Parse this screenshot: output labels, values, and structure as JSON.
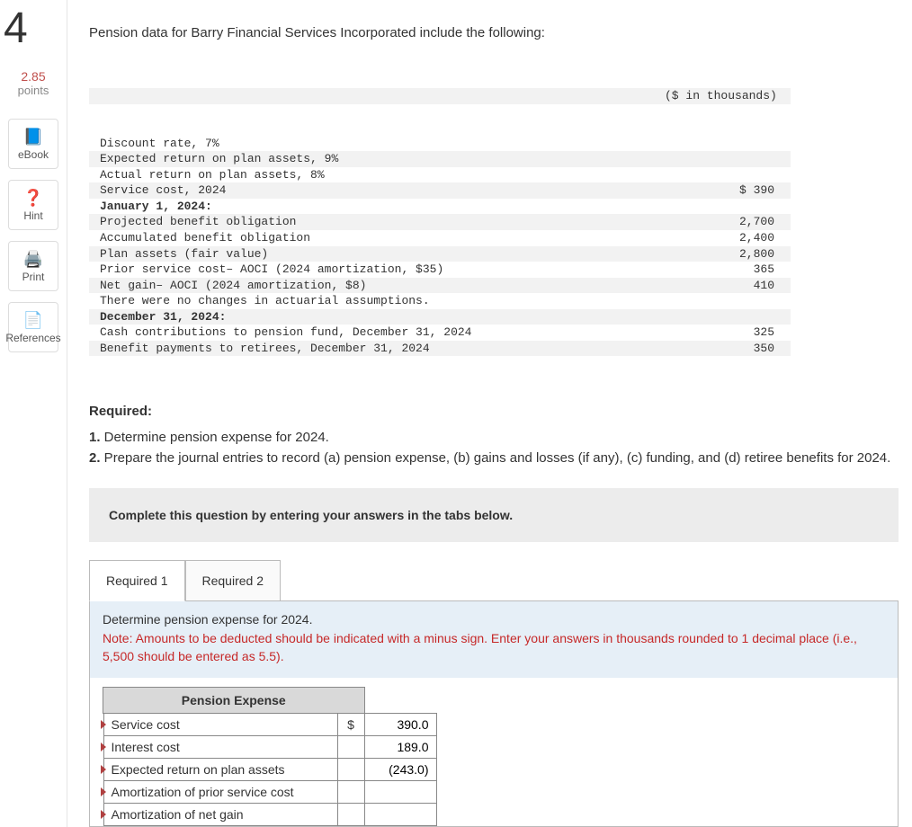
{
  "question_number": "4",
  "points": {
    "value": "2.85",
    "label": "points"
  },
  "side_buttons": [
    {
      "name": "ebook",
      "icon": "📘",
      "label": "eBook"
    },
    {
      "name": "hint",
      "icon": "❓",
      "label": "Hint"
    },
    {
      "name": "print",
      "icon": "🖨️",
      "label": "Print"
    },
    {
      "name": "references",
      "icon": "📄",
      "label": "References"
    }
  ],
  "intro": "Pension data for Barry Financial Services Incorporated include the following:",
  "data_header": "($ in thousands)",
  "data_rows": [
    {
      "label": "Discount rate, 7%",
      "value": "",
      "bold": false
    },
    {
      "label": "Expected return on plan assets, 9%",
      "value": "",
      "bold": false
    },
    {
      "label": "Actual return on plan assets, 8%",
      "value": "",
      "bold": false
    },
    {
      "label": "Service cost, 2024",
      "value": "$ 390",
      "bold": false
    },
    {
      "label": "January 1, 2024:",
      "value": "",
      "bold": true
    },
    {
      "label": "Projected benefit obligation",
      "value": "2,700",
      "bold": false
    },
    {
      "label": "Accumulated benefit obligation",
      "value": "2,400",
      "bold": false
    },
    {
      "label": "Plan assets (fair value)",
      "value": "2,800",
      "bold": false
    },
    {
      "label": "Prior service cost– AOCI (2024 amortization, $35)",
      "value": "365",
      "bold": false
    },
    {
      "label": "Net gain– AOCI (2024 amortization, $8)",
      "value": "410",
      "bold": false
    },
    {
      "label": "There were no changes in actuarial assumptions.",
      "value": "",
      "bold": false
    },
    {
      "label": "December 31, 2024:",
      "value": "",
      "bold": true
    },
    {
      "label": "Cash contributions to pension fund, December 31, 2024",
      "value": "325",
      "bold": false
    },
    {
      "label": "Benefit payments to retirees, December 31, 2024",
      "value": "350",
      "bold": false
    }
  ],
  "required_heading": "Required:",
  "requirements": [
    {
      "num": "1.",
      "text": "Determine pension expense for 2024."
    },
    {
      "num": "2.",
      "text": "Prepare the journal entries to record (a) pension expense, (b) gains and losses (if any), (c) funding, and (d) retiree benefits for 2024."
    }
  ],
  "instruction_box": "Complete this question by entering your answers in the tabs below.",
  "tabs": [
    {
      "label": "Required 1",
      "active": true
    },
    {
      "label": "Required 2",
      "active": false
    }
  ],
  "panel": {
    "prompt": "Determine pension expense for 2024.",
    "note": "Note: Amounts to be deducted should be indicated with a minus sign. Enter your answers in thousands rounded to 1 decimal place (i.e., 5,500 should be entered as 5.5).",
    "table_header": "Pension Expense",
    "rows": [
      {
        "label": "Service cost",
        "symbol": "$",
        "value": "390.0"
      },
      {
        "label": "Interest cost",
        "symbol": "",
        "value": "189.0"
      },
      {
        "label": "Expected return on plan assets",
        "symbol": "",
        "value": "(243.0)"
      },
      {
        "label": "Amortization of prior service cost",
        "symbol": "",
        "value": ""
      },
      {
        "label": "Amortization of net gain",
        "symbol": "",
        "value": ""
      }
    ]
  }
}
